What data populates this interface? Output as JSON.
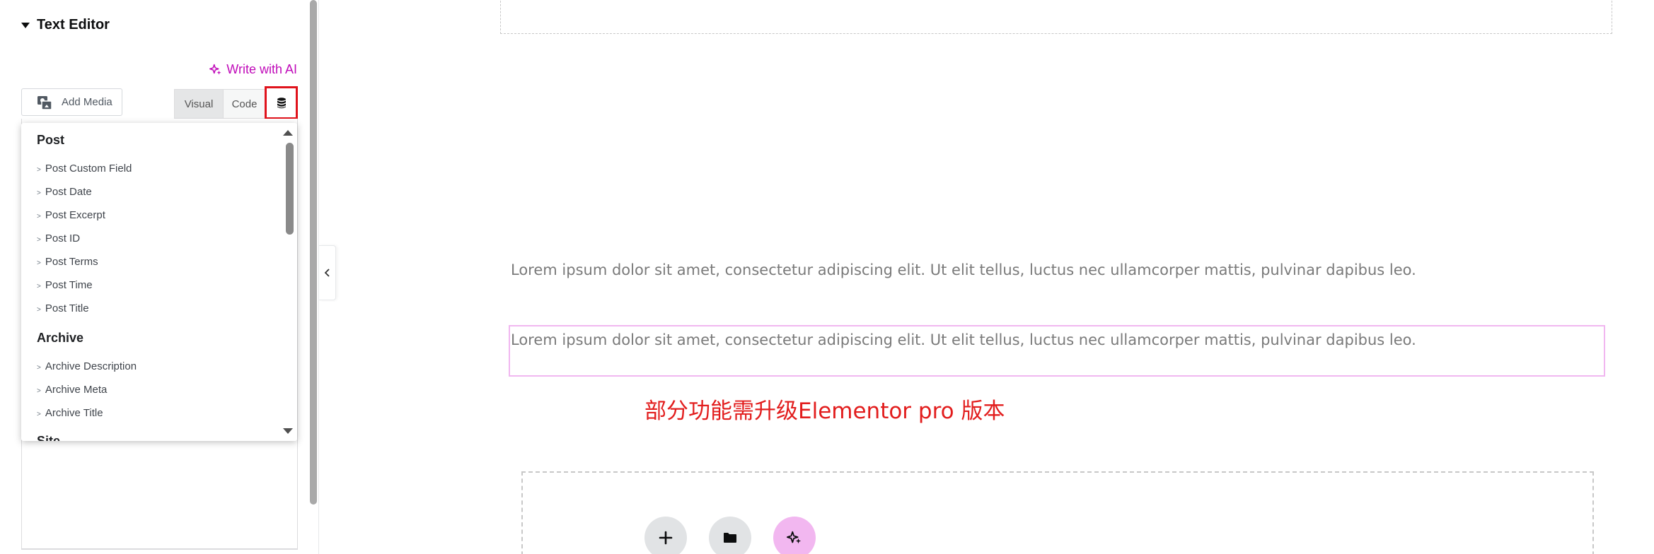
{
  "sidebar": {
    "section_title": "Text Editor",
    "write_ai_label": "Write with AI",
    "add_media_label": "Add Media",
    "tabs": {
      "visual": "Visual",
      "code": "Code"
    },
    "dynamic_tags_icon": "database-icon",
    "dropdown": {
      "groups": [
        {
          "title": "Post",
          "items": [
            "Post Custom Field",
            "Post Date",
            "Post Excerpt",
            "Post ID",
            "Post Terms",
            "Post Time",
            "Post Title"
          ]
        },
        {
          "title": "Archive",
          "items": [
            "Archive Description",
            "Archive Meta",
            "Archive Title"
          ]
        },
        {
          "title": "Site",
          "items": []
        }
      ]
    }
  },
  "canvas": {
    "paragraph_1": "Lorem ipsum dolor sit amet, consectetur adipiscing elit. Ut elit tellus, luctus nec ullamcorper mattis, pulvinar dapibus leo.",
    "paragraph_2": "Lorem ipsum dolor sit amet, consectetur adipiscing elit. Ut elit tellus, luctus nec ullamcorper mattis, pulvinar dapibus leo.",
    "annotation": "部分功能需升级Elementor pro 版本",
    "add_section_buttons": [
      "plus-icon",
      "folder-icon",
      "ai-sparkle-icon"
    ]
  },
  "colors": {
    "ai_accent": "#c00bb9",
    "highlight_border": "#e0131c",
    "selection_outline": "#f1b7f0",
    "annotation_red": "#e21d1d"
  }
}
